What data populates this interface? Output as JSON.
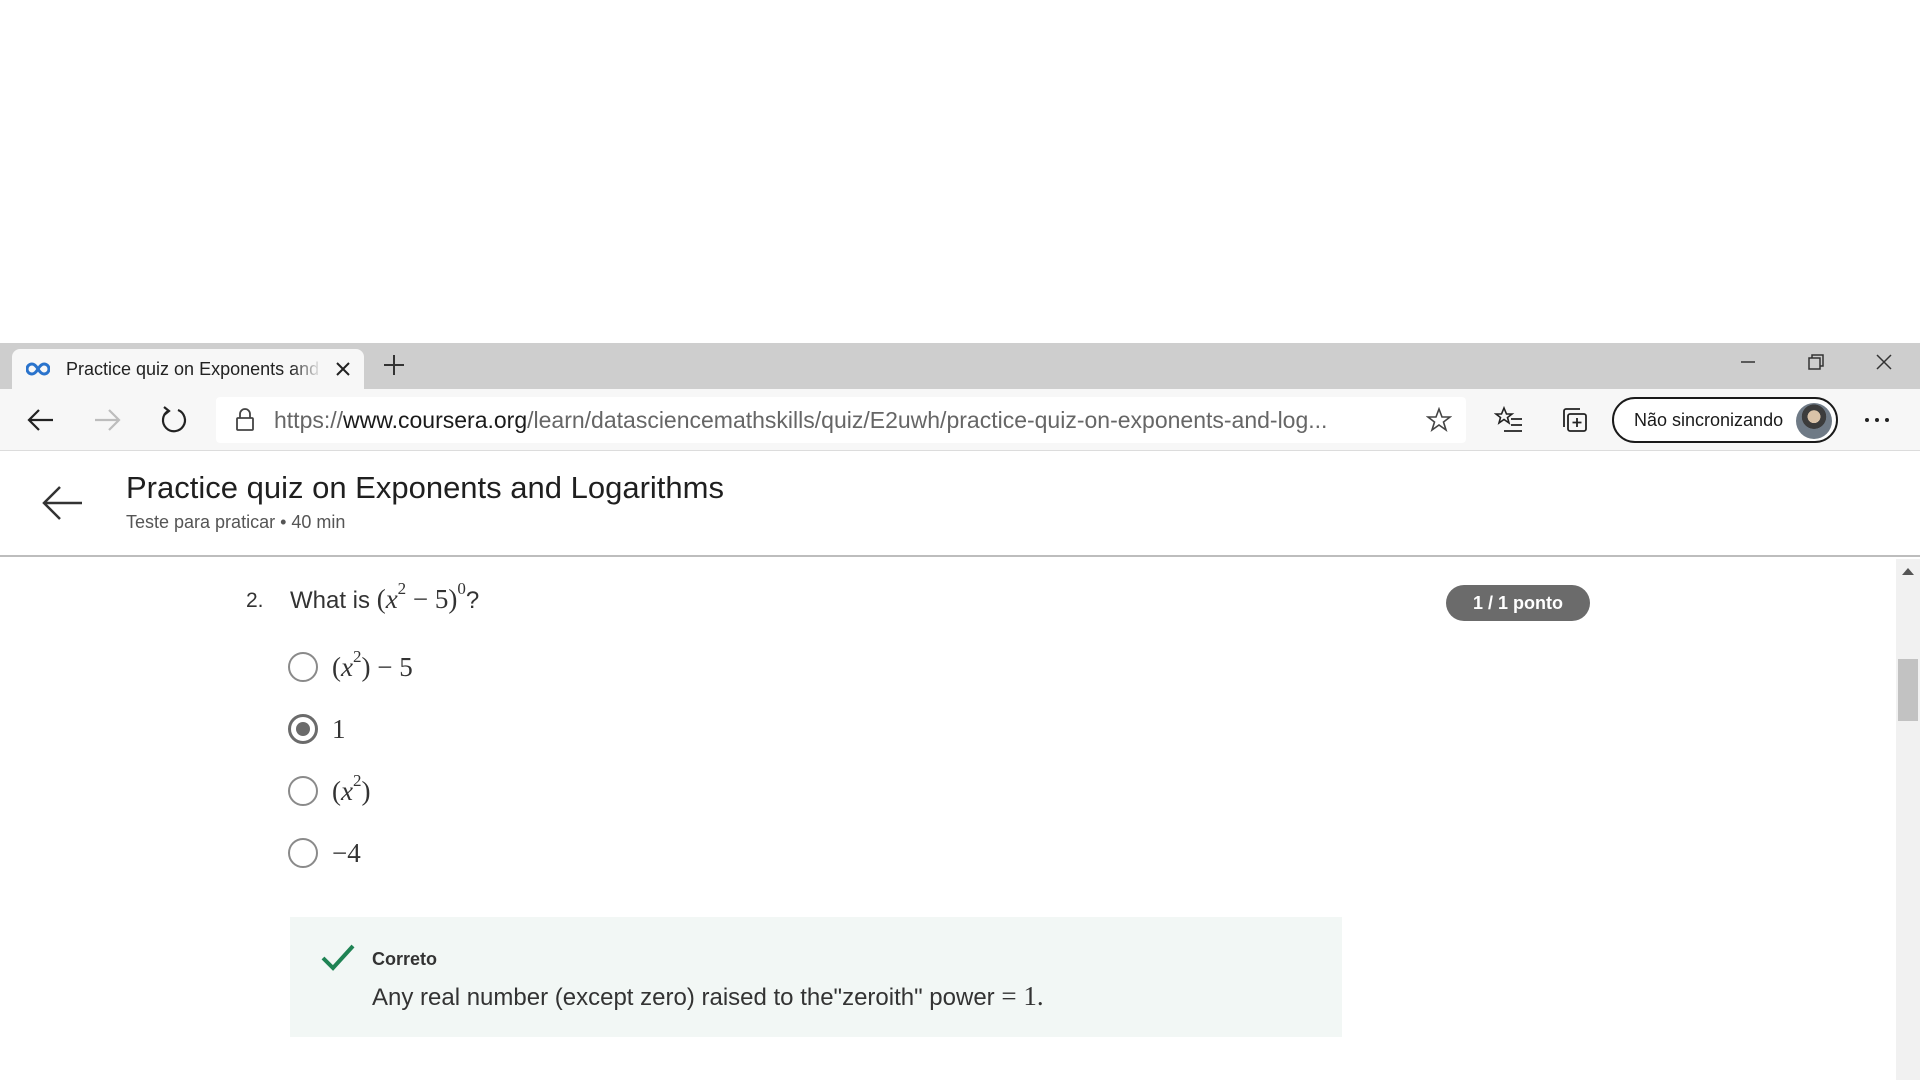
{
  "browser": {
    "tab_title": "Practice quiz on Exponents and Logarithms",
    "url_scheme": "https://",
    "url_host": "www.coursera.org",
    "url_path": "/learn/datasciencemathskills/quiz/E2uwh/practice-quiz-on-exponents-and-log...",
    "sync_label": "Não sincronizando",
    "icons": [
      "coursera-logo-icon",
      "close-icon",
      "plus-icon",
      "minimize-icon",
      "restore-icon",
      "window-close-icon",
      "back-arrow-icon",
      "forward-arrow-icon",
      "refresh-icon",
      "lock-icon",
      "star-icon",
      "favorites-icon",
      "collections-icon",
      "more-icon"
    ]
  },
  "header": {
    "title": "Practice quiz on Exponents and Logarithms",
    "subtitle": "Teste para praticar • 40 min"
  },
  "question": {
    "number": "2.",
    "prefix": "What is",
    "points": "1 / 1 ponto",
    "selected_option_index": 1,
    "options": [
      {
        "id": "a"
      },
      {
        "id": "b",
        "text": "1"
      },
      {
        "id": "c"
      },
      {
        "id": "d",
        "text": "−4"
      }
    ]
  },
  "feedback": {
    "title": "Correto",
    "text": "Any real number (except zero) raised to the\"zeroith\" power",
    "equals_value": "= 1.",
    "accent_color": "#1f8354"
  },
  "colors": {
    "tab_strip": "#cecece",
    "toolbar": "#f7f7f7",
    "badge": "#6b6b6b",
    "feedback_bg": "#f2f7f5"
  }
}
